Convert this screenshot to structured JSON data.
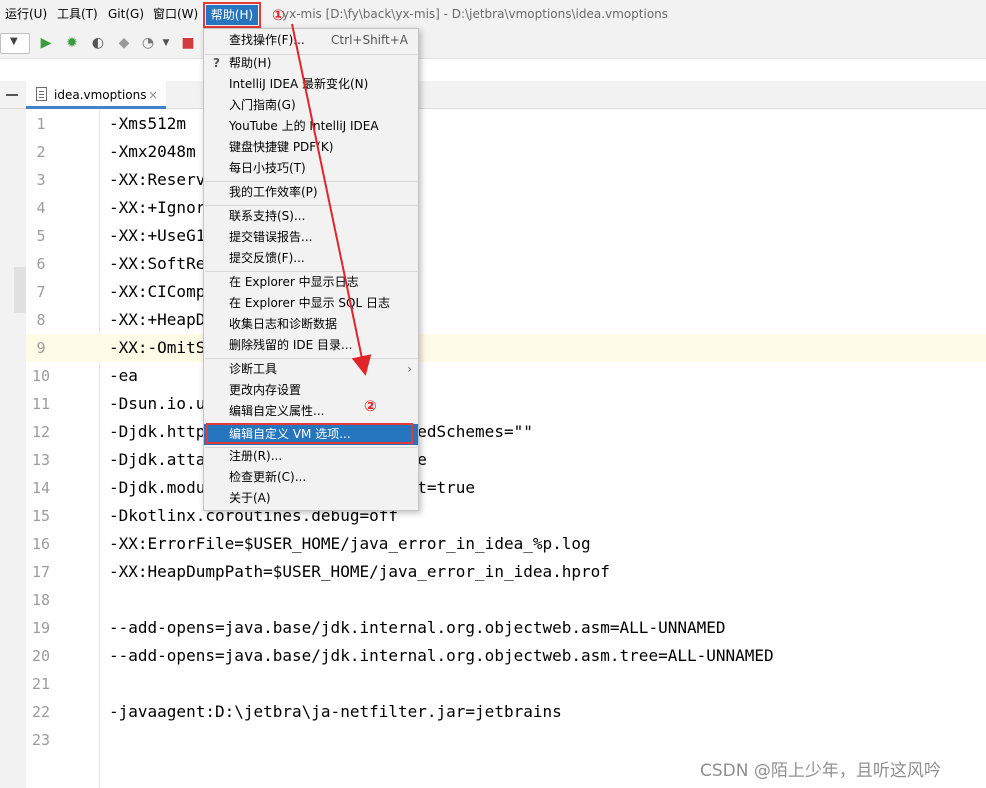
{
  "menubar": {
    "items": [
      "运行(U)",
      "工具(T)",
      "Git(G)",
      "窗口(W)"
    ],
    "active_item": "帮助(H)",
    "window_title": "yx-mis [D:\\fy\\back\\yx-mis] - D:\\jetbra\\vmoptions\\idea.vmoptions"
  },
  "editor_tab": {
    "label": "idea.vmoptions",
    "close": "×"
  },
  "editor": {
    "current_line": 9,
    "line_numbers": [
      "1",
      "2",
      "3",
      "4",
      "5",
      "6",
      "7",
      "8",
      "9",
      "10",
      "11",
      "12",
      "13",
      "14",
      "15",
      "16",
      "17",
      "18",
      "19",
      "20",
      "21",
      "22",
      "23"
    ],
    "lines": [
      "-Xms512m",
      "-Xmx2048m",
      "-XX:ReservedCodeCacheSize=512m",
      "-XX:+IgnoreUnrecognizedVMOptions",
      "-XX:+UseG1GC",
      "-XX:SoftRefLRUPolicyMSPerMB=50",
      "-XX:CICompilerCount=2",
      "-XX:+HeapDumpOnOutOfMemoryError",
      "-XX:-OmitStackTraceInFastThrow",
      "-ea",
      "-Dsun.io.useCanonCaches=false",
      "-Djdk.http.auth.tunneling.disabledSchemes=\"\"",
      "-Djdk.attach.allowAttachSelf=true",
      "-Djdk.module.illegalAccess.silent=true",
      "-Dkotlinx.coroutines.debug=off",
      "-XX:ErrorFile=$USER_HOME/java_error_in_idea_%p.log",
      "-XX:HeapDumpPath=$USER_HOME/java_error_in_idea.hprof",
      "",
      "--add-opens=java.base/jdk.internal.org.objectweb.asm=ALL-UNNAMED",
      "--add-opens=java.base/jdk.internal.org.objectweb.asm.tree=ALL-UNNAMED",
      "",
      "-javaagent:D:\\jetbra\\ja-netfilter.jar=jetbrains",
      ""
    ]
  },
  "help_menu": {
    "find_action": {
      "label": "查找操作(F)...",
      "shortcut": "Ctrl+Shift+A"
    },
    "help": "帮助(H)",
    "whats_new": "IntelliJ IDEA 最新变化(N)",
    "getting_started": "入门指南(G)",
    "youtube": "YouTube 上的 IntelliJ IDEA",
    "keymap_pdf": "键盘快捷键 PDF(K)",
    "tip_of_day": "每日小技巧(T)",
    "productivity": "我的工作效率(P)",
    "contact_support": "联系支持(S)...",
    "submit_bug": "提交错误报告...",
    "submit_feedback": "提交反馈(F)...",
    "show_log": "在 Explorer 中显示日志",
    "show_sql_log": "在 Explorer 中显示 SQL 日志",
    "collect_logs": "收集日志和诊断数据",
    "delete_leftover": "删除残留的 IDE 目录...",
    "diagnostic_tools": "诊断工具",
    "change_memory": "更改内存设置",
    "edit_custom_props": "编辑自定义属性...",
    "edit_custom_vm": "编辑自定义 VM 选项...",
    "register": "注册(R)...",
    "check_updates": "检查更新(C)...",
    "about": "关于(A)"
  },
  "annotations": {
    "step1": "①",
    "step2": "②",
    "color": "#e0262a"
  },
  "watermark": "CSDN @陌上少年，且听这风吟",
  "colors": {
    "accent": "#2675bf",
    "current_line": "#fefbe7",
    "annotation_red": "#e23a3a"
  }
}
